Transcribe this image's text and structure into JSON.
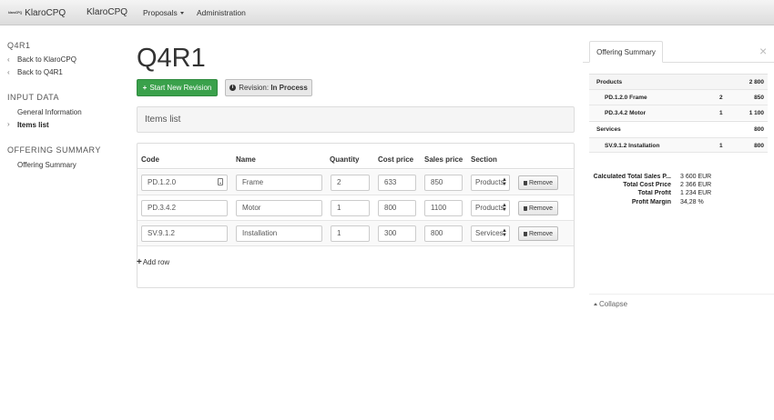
{
  "navbar": {
    "brand_small": "klaroCPQ",
    "brand_title": "KlaroCPQ",
    "brand_link": "KlaroCPQ",
    "proposals": "Proposals",
    "administration": "Administration"
  },
  "sidebar": {
    "project_head": "Q4R1",
    "back_klaro": "Back to KlaroCPQ",
    "back_q4r1": "Back to Q4R1",
    "input_head": "INPUT DATA",
    "general_info": "General Information",
    "items_list": "Items list",
    "offering_head": "OFFERING SUMMARY",
    "offering_summary": "Offering Summary"
  },
  "main": {
    "title": "Q4R1",
    "new_revision": "Start New Revision",
    "revision_label": "Revision:",
    "revision_status": "In Process",
    "items_heading": "Items list",
    "columns": {
      "code": "Code",
      "name": "Name",
      "quantity": "Quantity",
      "cost": "Cost price",
      "sales": "Sales price",
      "section": "Section"
    },
    "rows": [
      {
        "code": "PD.1.2.0",
        "name": "Frame",
        "quantity": "2",
        "cost": "633",
        "sales": "850",
        "section": "Products"
      },
      {
        "code": "PD.3.4.2",
        "name": "Motor",
        "quantity": "1",
        "cost": "800",
        "sales": "1100",
        "section": "Products"
      },
      {
        "code": "SV.9.1.2",
        "name": "Installation",
        "quantity": "1",
        "cost": "300",
        "sales": "800",
        "section": "Services"
      }
    ],
    "remove_label": "Remove",
    "add_row": "Add row"
  },
  "summary": {
    "tab": "Offering Summary",
    "close": "×",
    "products_label": "Products",
    "products_total": "2 800",
    "items_products": [
      {
        "label": "PD.1.2.0 Frame",
        "qty": "2",
        "value": "850"
      },
      {
        "label": "PD.3.4.2 Motor",
        "qty": "1",
        "value": "1 100"
      }
    ],
    "services_label": "Services",
    "services_total": "800",
    "items_services": [
      {
        "label": "SV.9.1.2 Installation",
        "qty": "1",
        "value": "800"
      }
    ],
    "totals": {
      "sales_label": "Calculated Total Sales P...",
      "sales_value": "3 600 EUR",
      "cost_label": "Total Cost Price",
      "cost_value": "2 366 EUR",
      "profit_label": "Total Profit",
      "profit_value": "1 234 EUR",
      "margin_label": "Profit Margin",
      "margin_value": "34,28 %"
    },
    "collapse": "Collapse"
  },
  "colors": {
    "accent_green": "#3aa14b"
  }
}
